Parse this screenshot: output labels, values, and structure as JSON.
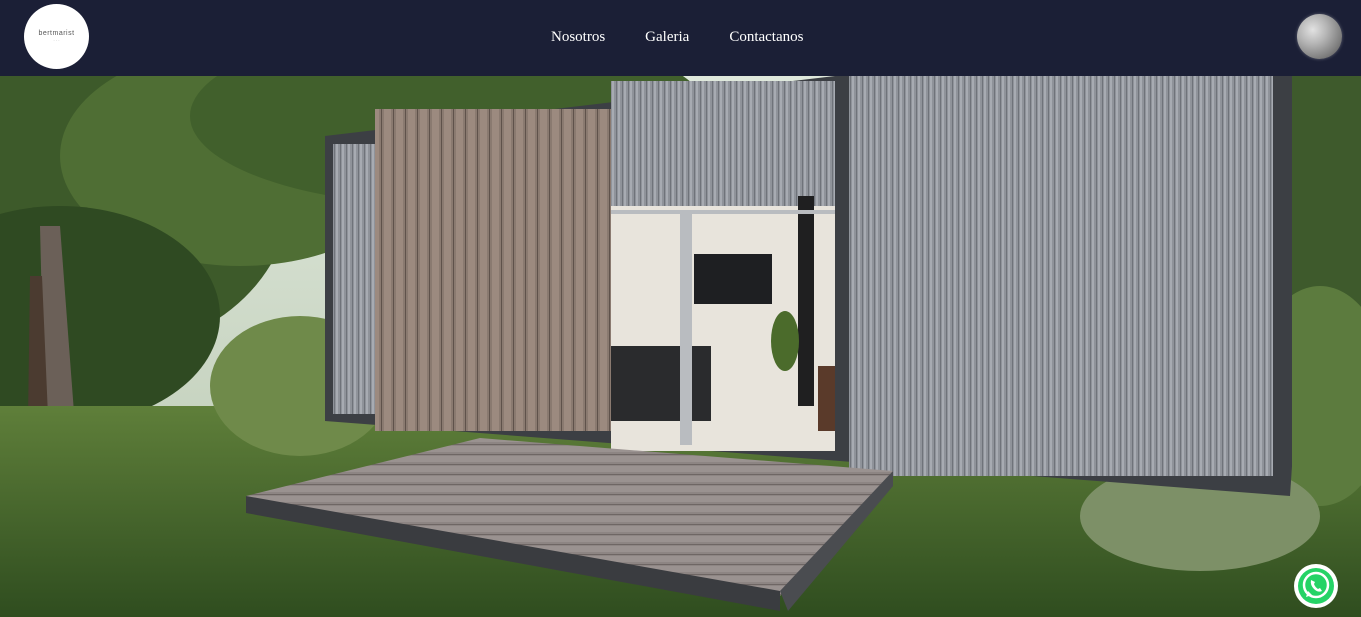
{
  "brand": {
    "logo_text": "bertmarist",
    "logo_subtext": "· · ·"
  },
  "nav": {
    "items": [
      {
        "label": "Nosotros"
      },
      {
        "label": "Galeria"
      },
      {
        "label": "Contactanos"
      }
    ]
  },
  "theme": {
    "navbar_bg": "#1b1f36",
    "nav_text": "#ffffff",
    "whatsapp_green": "#25d366"
  },
  "icons": {
    "theme_toggle": "moon-icon",
    "chat": "whatsapp-icon"
  },
  "hero": {
    "image": "modular-house-render"
  }
}
